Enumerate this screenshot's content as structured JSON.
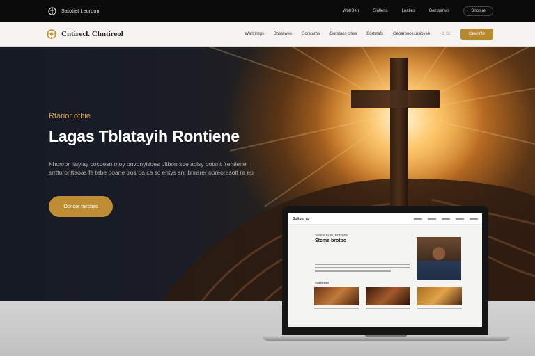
{
  "topbar": {
    "brand": "Satotiet Leoroom",
    "links": [
      "WotrBen",
      "Sintiens",
      "Loaties",
      "Bontsenws"
    ],
    "pill": "Snotcre"
  },
  "navbar": {
    "logo_text": "Cntirecl. Chntireol",
    "menu": [
      "Wartrirngs",
      "Bostawes",
      "Gorstaros",
      "Gorstaos crtes",
      "Bortstafs",
      "Geoarbocecusiovee"
    ],
    "extra": "·  £ Sc",
    "cta": "Geerinte"
  },
  "hero": {
    "eyebrow": "Rtarior othie",
    "title": "Lagas Tblatayih Rontiene",
    "desc": "Khonror Itayiay cocoesn otoy onvonyisoes oltbon sbe acisy ootsnt frentiene srrttoronttaoas fe tebe ooane trosroa ca sc ehtys snr bnrarer ooreorasott ra ep",
    "button": "Ocnoor tnscbes"
  },
  "laptop": {
    "mini_logo": "Soltutu ro",
    "mini_heading_small": "Sbaue ruuh, Bnrsorlo",
    "mini_heading": "Stcme brotbo",
    "mini_sub": "Sbadsreuvs"
  },
  "colors": {
    "accent": "#bf8d33",
    "topbar_bg": "#0b0b0c",
    "navbar_bg": "#f5f4f1"
  }
}
